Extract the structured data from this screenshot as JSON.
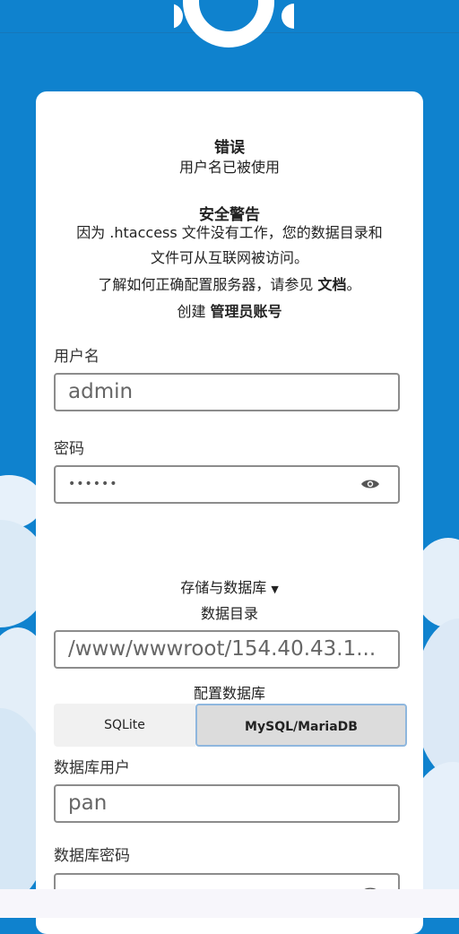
{
  "error": {
    "title": "错误",
    "message": "用户名已被使用"
  },
  "security": {
    "title": "安全警告",
    "line1": "因为 .htaccess 文件没有工作，您的数据目录和",
    "line2": "文件可从互联网被访问。",
    "docs_prefix": "了解如何正确配置服务器，请参见",
    "docs_link": "文档",
    "docs_suffix": "。"
  },
  "create": {
    "prefix": "创建",
    "emphasis": "管理员账号"
  },
  "form": {
    "username_label": "用户名",
    "username_value": "admin",
    "password_label": "密码",
    "password_value": "••••••",
    "storage_toggle": "存储与数据库",
    "datadir_label": "数据目录",
    "datadir_value": "/www/wwwroot/154.40.43.1...",
    "db_config_label": "配置数据库",
    "db_options": [
      "SQLite",
      "MySQL/MariaDB"
    ],
    "db_selected": "MySQL/MariaDB",
    "db_user_label": "数据库用户",
    "db_user_value": "pan",
    "db_password_label": "数据库密码"
  },
  "colors": {
    "background": "#0f82ce",
    "card": "#ffffff",
    "selected_border": "#8fb7de"
  },
  "icons": [
    "nextcloud-logo",
    "eye-icon",
    "caret-down-icon"
  ]
}
